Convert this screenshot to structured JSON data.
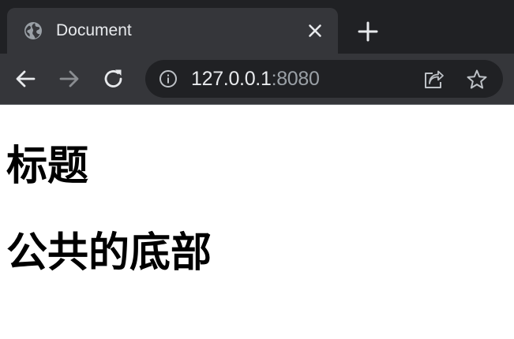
{
  "browser": {
    "tab": {
      "title": "Document",
      "favicon": "globe-icon"
    },
    "new_tab_icon": "plus-icon",
    "toolbar": {
      "back_icon": "arrow-left-icon",
      "forward_icon": "arrow-right-icon",
      "reload_icon": "reload-icon",
      "site_info_icon": "info-icon",
      "url_host": "127.0.0.1",
      "url_port": ":8080",
      "share_icon": "share-icon",
      "bookmark_icon": "star-icon"
    },
    "colors": {
      "tab_strip_bg": "#202124",
      "tab_bg": "#35363a",
      "text": "#e8eaed",
      "muted": "#9aa0a6",
      "omnibox_bg": "#202124"
    }
  },
  "page": {
    "heading_title": "标题",
    "heading_footer": "公共的底部"
  }
}
